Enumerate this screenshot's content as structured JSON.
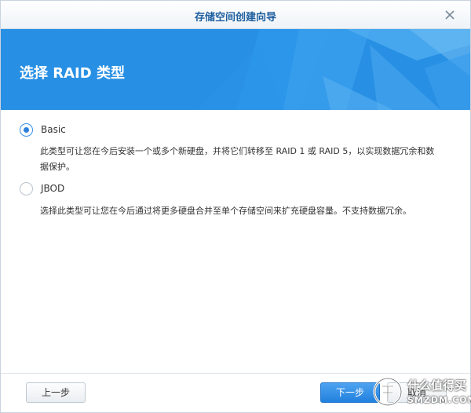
{
  "window": {
    "title": "存储空间创建向导"
  },
  "banner": {
    "heading": "选择 RAID 类型"
  },
  "options": [
    {
      "label": "Basic",
      "checked": true,
      "description_line1": "此类型可让您在今后安装一个或多个新硬盘，并将它们转移至 RAID 1 或 RAID 5，以实现数据冗余和数",
      "description_line2": "据保护。"
    },
    {
      "label": "JBOD",
      "checked": false,
      "description_line1": "选择此类型可让您在今后通过将更多硬盘合并至单个存储空间来扩充硬盘容量。不支持数据冗余。"
    }
  ],
  "footer": {
    "prev_label": "上一步",
    "next_label": "下一步",
    "cancel_label": "取消"
  },
  "watermark": {
    "cn": "什么值得买",
    "en": "SMZDM.COM"
  },
  "colors": {
    "banner": "#2890e4",
    "title_text": "#1d5e9f",
    "primary_button": "#2280de"
  }
}
